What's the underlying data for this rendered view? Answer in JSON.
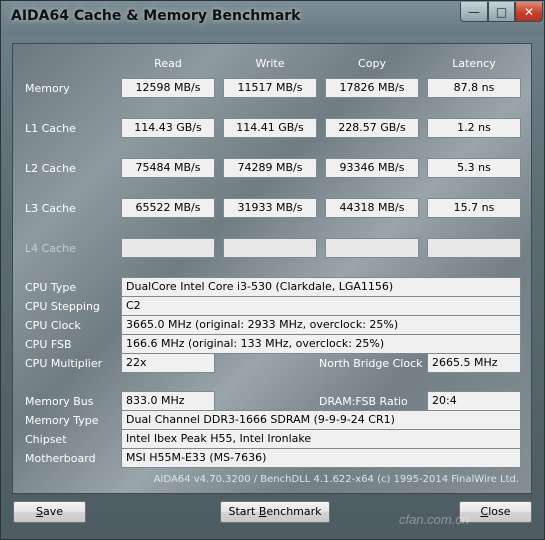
{
  "window": {
    "title": "AIDA64 Cache & Memory Benchmark",
    "minimize_glyph": "—",
    "maximize_glyph": "□",
    "close_glyph": "✕"
  },
  "columns": {
    "read": "Read",
    "write": "Write",
    "copy": "Copy",
    "latency": "Latency"
  },
  "rows": {
    "memory": {
      "label": "Memory",
      "read": "12598 MB/s",
      "write": "11517 MB/s",
      "copy": "17826 MB/s",
      "latency": "87.8 ns"
    },
    "l1": {
      "label": "L1 Cache",
      "read": "114.43 GB/s",
      "write": "114.41 GB/s",
      "copy": "228.57 GB/s",
      "latency": "1.2 ns"
    },
    "l2": {
      "label": "L2 Cache",
      "read": "75484 MB/s",
      "write": "74289 MB/s",
      "copy": "93346 MB/s",
      "latency": "5.3 ns"
    },
    "l3": {
      "label": "L3 Cache",
      "read": "65522 MB/s",
      "write": "31933 MB/s",
      "copy": "44318 MB/s",
      "latency": "15.7 ns"
    },
    "l4": {
      "label": "L4 Cache",
      "read": "",
      "write": "",
      "copy": "",
      "latency": ""
    }
  },
  "info": {
    "cpu_type_label": "CPU Type",
    "cpu_type": "DualCore Intel Core i3-530  (Clarkdale, LGA1156)",
    "cpu_stepping_label": "CPU Stepping",
    "cpu_stepping": "C2",
    "cpu_clock_label": "CPU Clock",
    "cpu_clock": "3665.0 MHz  (original: 2933 MHz, overclock: 25%)",
    "cpu_fsb_label": "CPU FSB",
    "cpu_fsb": "166.6 MHz  (original: 133 MHz, overclock: 25%)",
    "cpu_multiplier_label": "CPU Multiplier",
    "cpu_multiplier": "22x",
    "north_bridge_clock_label": "North Bridge Clock",
    "north_bridge_clock": "2665.5 MHz",
    "memory_bus_label": "Memory Bus",
    "memory_bus": "833.0 MHz",
    "dram_fsb_ratio_label": "DRAM:FSB Ratio",
    "dram_fsb_ratio": "20:4",
    "memory_type_label": "Memory Type",
    "memory_type": "Dual Channel DDR3-1666 SDRAM  (9-9-9-24 CR1)",
    "chipset_label": "Chipset",
    "chipset": "Intel Ibex Peak H55, Intel Ironlake",
    "motherboard_label": "Motherboard",
    "motherboard": "MSI H55M-E33 (MS-7636)"
  },
  "footer": "AIDA64 v4.70.3200 / BenchDLL 4.1.622-x64  (c) 1995-2014 FinalWire Ltd.",
  "buttons": {
    "save_mnemonic": "S",
    "save_rest": "ave",
    "start_pre": "Start ",
    "start_mnemonic": "B",
    "start_rest": "enchmark",
    "close_mnemonic": "C",
    "close_rest": "lose"
  },
  "watermark": "cfan.com.cn"
}
